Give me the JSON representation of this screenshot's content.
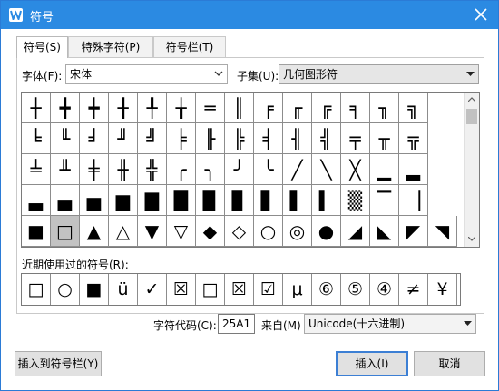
{
  "window": {
    "title": "符号",
    "close_label": "close"
  },
  "tabs": [
    {
      "label": "符号(S)",
      "active": true
    },
    {
      "label": "特殊字符(P)",
      "active": false
    },
    {
      "label": "符号栏(T)",
      "active": false
    }
  ],
  "font": {
    "label": "字体(F):",
    "value": "宋体"
  },
  "subset": {
    "label": "子集(U):",
    "value": "几何图形符"
  },
  "symbol_grid": {
    "selected_row": 5,
    "selected_col": 1,
    "rows": [
      [
        "┼",
        "╋",
        "┿",
        "╂",
        "╀",
        "╁",
        "═",
        "║",
        "╒",
        "╓",
        "╔",
        "╕",
        "╖",
        "╗"
      ],
      [
        "╘",
        "╙",
        "╛",
        "╜",
        "╝",
        "╞",
        "╟",
        "╠",
        "╡",
        "╢",
        "╣",
        "╤",
        "╥",
        "╦"
      ],
      [
        "╧",
        "╨",
        "╪",
        "╫",
        "╬",
        "╭",
        "╮",
        "╯",
        "╰",
        "╱",
        "╲",
        "╳",
        "▁",
        "▂"
      ],
      [
        "▃",
        "▄",
        "▅",
        "▆",
        "▇",
        "█",
        "▉",
        "▊",
        "▋",
        "▌",
        "▍",
        "▒",
        "▔",
        "▕"
      ],
      [
        "■",
        "□",
        "▲",
        "△",
        "▼",
        "▽",
        "◆",
        "◇",
        "○",
        "◎",
        "●",
        "◢",
        "◣",
        "◤",
        "◥"
      ]
    ]
  },
  "recent": {
    "label": "近期使用过的符号(R):",
    "symbols": [
      "□",
      "○",
      "■",
      "ü",
      "✓",
      "☒",
      "□",
      "☒",
      "☑",
      "μ",
      "⑥",
      "⑤",
      "④",
      "≠",
      "¥"
    ]
  },
  "char_code": {
    "label": "字符代码(C):",
    "value": "25A1"
  },
  "from": {
    "label": "来自(M)",
    "value": "Unicode(十六进制)"
  },
  "buttons": {
    "insert_to_bar": "插入到符号栏(Y)",
    "insert": "插入(I)",
    "cancel": "取消"
  }
}
